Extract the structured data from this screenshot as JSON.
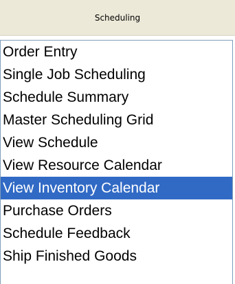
{
  "header": {
    "title": "Scheduling"
  },
  "menu": {
    "selected_index": 6,
    "items": [
      {
        "label": "Order Entry"
      },
      {
        "label": "Single Job Scheduling"
      },
      {
        "label": "Schedule Summary"
      },
      {
        "label": "Master Scheduling Grid"
      },
      {
        "label": "View Schedule"
      },
      {
        "label": "View Resource Calendar"
      },
      {
        "label": "View Inventory Calendar"
      },
      {
        "label": "Purchase Orders"
      },
      {
        "label": "Schedule Feedback"
      },
      {
        "label": "Ship Finished Goods"
      }
    ]
  },
  "colors": {
    "header_background": "#ece9d8",
    "selection_background": "#316ac5",
    "selection_text": "#ffffff",
    "list_border": "#7f9db9"
  }
}
